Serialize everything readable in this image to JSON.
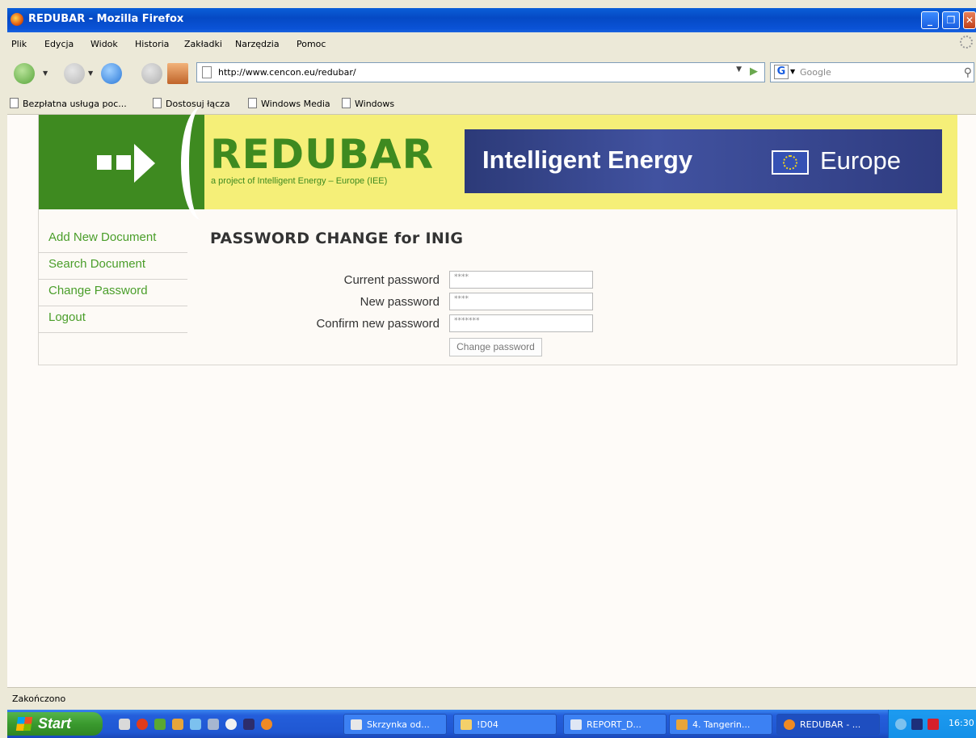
{
  "window": {
    "title": "REDUBAR - Mozilla Firefox"
  },
  "menu": [
    "Plik",
    "Edycja",
    "Widok",
    "Historia",
    "Zakładki",
    "Narzędzia",
    "Pomoc"
  ],
  "nav": {
    "url": "http://www.cencon.eu/redubar/",
    "search_placeholder": "Google"
  },
  "bookmarks": [
    "Bezpłatna usługa poc...",
    "Dostosuj łącza",
    "Windows Media",
    "Windows"
  ],
  "site": {
    "logo_word": "REDUBAR",
    "logo_sub": "a project of Intelligent Energy – Europe (IEE)",
    "iee_left": "Intelligent Energy",
    "iee_right": "Europe",
    "sidebar": [
      "Add New Document",
      "Search Document",
      "Change Password",
      "Logout"
    ],
    "heading": "PASSWORD CHANGE for INIG",
    "fields": [
      {
        "label": "Current password",
        "value": "****"
      },
      {
        "label": "New password",
        "value": "****"
      },
      {
        "label": "Confirm new password",
        "value": "*******"
      }
    ],
    "submit": "Change password"
  },
  "status": "Zakończono",
  "taskbar": {
    "start": "Start",
    "buttons": [
      "Skrzynka od...",
      "!D04",
      "REPORT_D...",
      "4. Tangerin...",
      "REDUBAR - ..."
    ],
    "clock": "16:30"
  },
  "colors": {
    "brand_green": "#3e8a20",
    "banner_yellow": "#f5ef78",
    "iee_blue": "#2c3a78",
    "link_green": "#4a9e2a"
  }
}
